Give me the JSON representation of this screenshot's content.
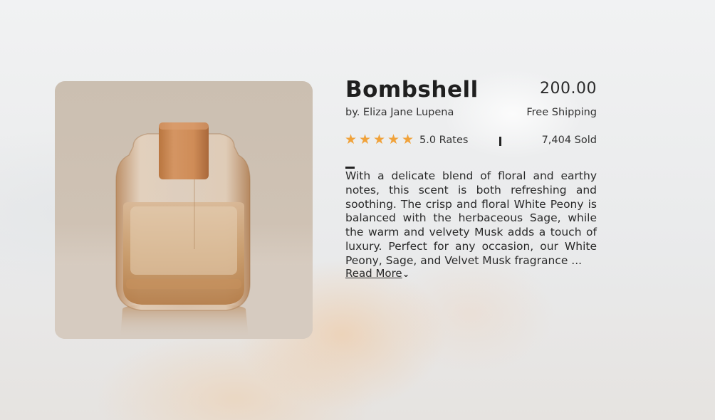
{
  "product": {
    "name": "Bombshell",
    "price": "200.00",
    "author": "by. Eliza Jane Lupena",
    "shipping": "Free Shipping",
    "rating": {
      "value": 5.0,
      "label": "5.0 Rates",
      "stars": [
        "★",
        "★",
        "★",
        "★",
        "★"
      ]
    },
    "sold": "7,404 Sold",
    "description": "With a delicate blend of floral and earthy notes, this scent is both refreshing and soothing. The crisp and floral White Peony is balanced with the herbaceous Sage, while the warm and velvety Musk adds a touch of luxury. Perfect for any occasion, our White Peony, Sage, and Velvet Musk fragrance ...",
    "read_more": "Read More",
    "image": {
      "subject": "perfume-bottle",
      "cap_color": "#c98852",
      "liquid_color": "#c89a68",
      "background_color": "#cbbfb1"
    }
  },
  "colors": {
    "star": "#f0a23a",
    "text": "#222222"
  },
  "icons": {
    "read_more": "chevron-down-icon",
    "star": "star-icon"
  }
}
